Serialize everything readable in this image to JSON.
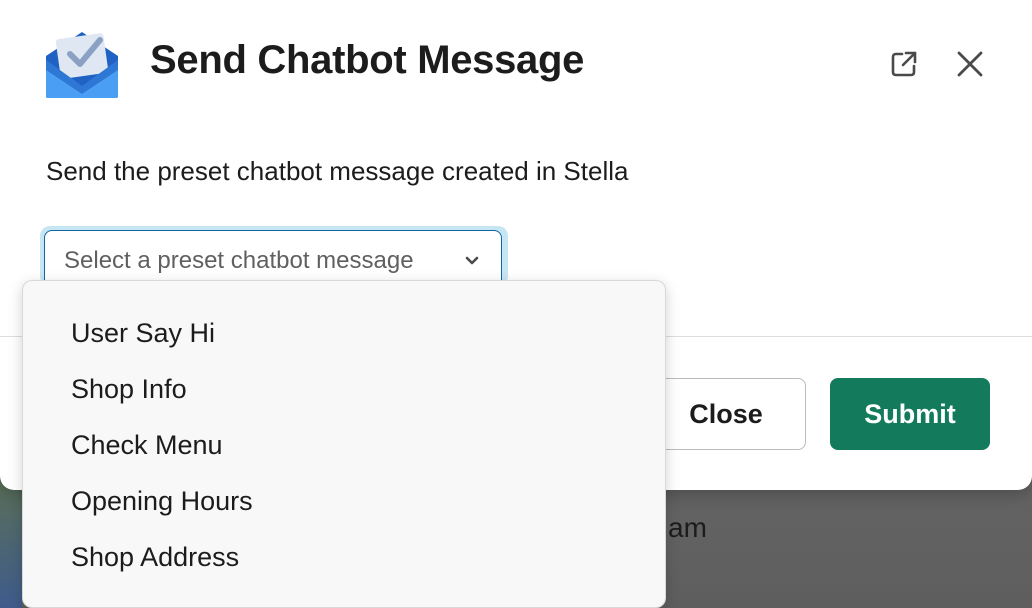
{
  "modal": {
    "title": "Send Chatbot Message",
    "description": "Send the preset chatbot message created in Stella",
    "external_link_icon": "external-link-icon",
    "close_icon": "close-icon",
    "app_icon": "inbox-check-icon"
  },
  "select": {
    "placeholder": "Select a preset chatbot message",
    "chevron_icon": "chevron-down-icon",
    "focus_color": "#1264a3"
  },
  "dropdown": {
    "options": [
      "User Say Hi",
      "Shop Info",
      "Check Menu",
      "Opening Hours",
      "Shop Address"
    ]
  },
  "footer": {
    "close_label": "Close",
    "submit_label": "Submit",
    "submit_color": "#147a5c"
  },
  "background": {
    "partial_text": "am"
  }
}
